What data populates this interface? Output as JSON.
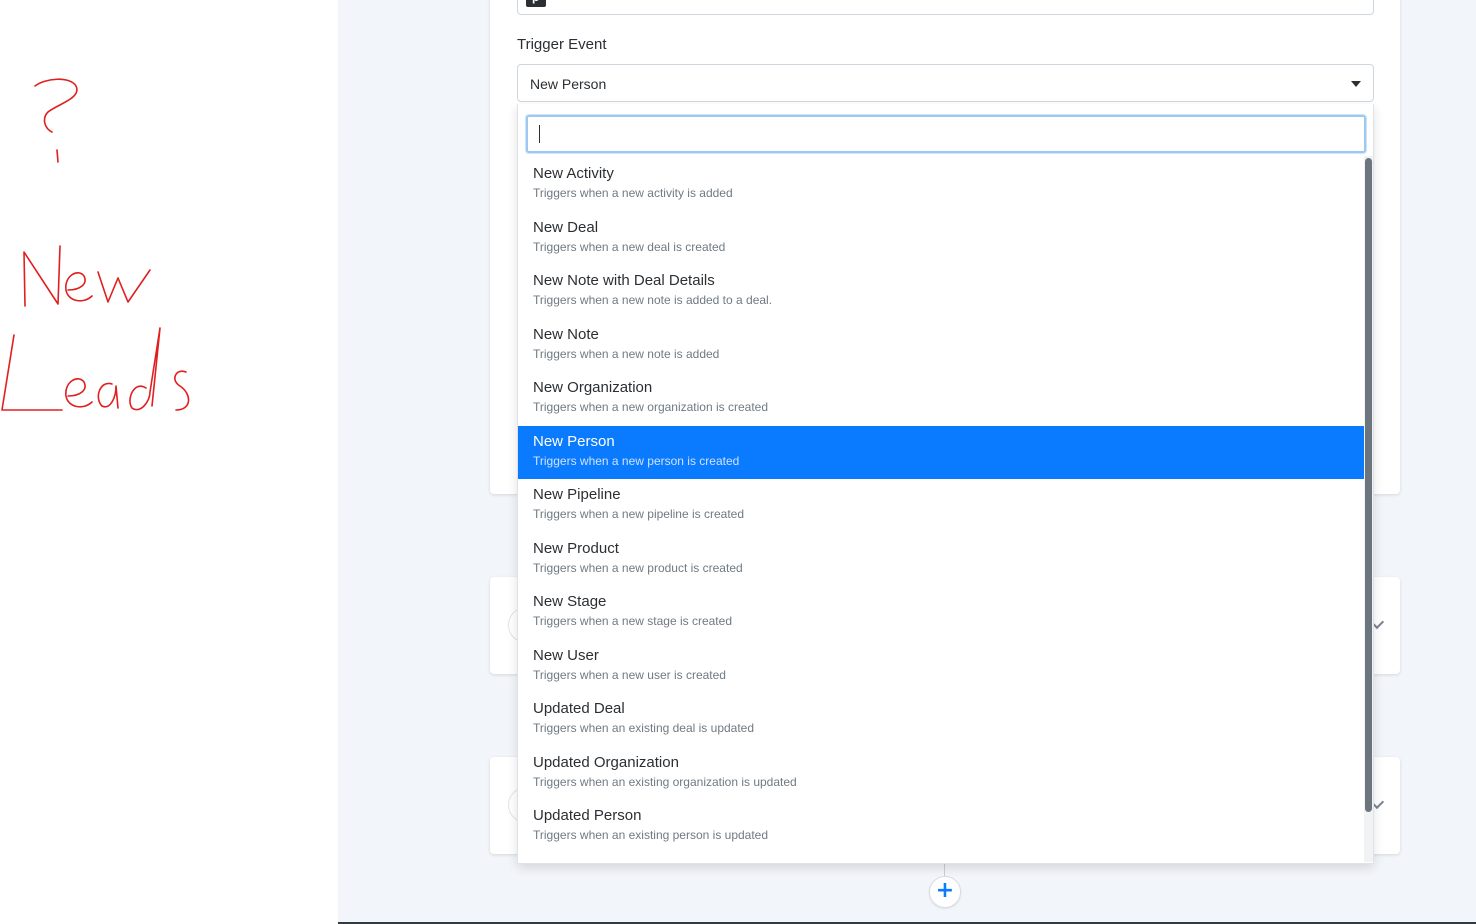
{
  "annotation": {
    "ink_color": "#e02020",
    "question_mark": "?",
    "line1": "New",
    "line2": "Leads"
  },
  "app_selector": {
    "icon": "pipedrive-logo-icon"
  },
  "trigger_event": {
    "label": "Trigger Event",
    "selected_value": "New Person",
    "search_value": "",
    "options": [
      {
        "title": "New Activity",
        "description": "Triggers when a new activity is added"
      },
      {
        "title": "New Deal",
        "description": "Triggers when a new deal is created"
      },
      {
        "title": "New Note with Deal Details",
        "description": "Triggers when a new note is added to a deal."
      },
      {
        "title": "New Note",
        "description": "Triggers when a new note is added"
      },
      {
        "title": "New Organization",
        "description": "Triggers when a new organization is created"
      },
      {
        "title": "New Person",
        "description": "Triggers when a new person is created"
      },
      {
        "title": "New Pipeline",
        "description": "Triggers when a new pipeline is created"
      },
      {
        "title": "New Product",
        "description": "Triggers when a new product is created"
      },
      {
        "title": "New Stage",
        "description": "Triggers when a new stage is created"
      },
      {
        "title": "New User",
        "description": "Triggers when a new user is created"
      },
      {
        "title": "Updated Deal",
        "description": "Triggers when an existing deal is updated"
      },
      {
        "title": "Updated Organization",
        "description": "Triggers when an existing organization is updated"
      },
      {
        "title": "Updated Person",
        "description": "Triggers when an existing person is updated"
      }
    ],
    "selected_index": 5
  },
  "add_step": {
    "label": "+"
  },
  "colors": {
    "accent": "#0a7aff",
    "canvas_bg": "#f2f5f9"
  }
}
